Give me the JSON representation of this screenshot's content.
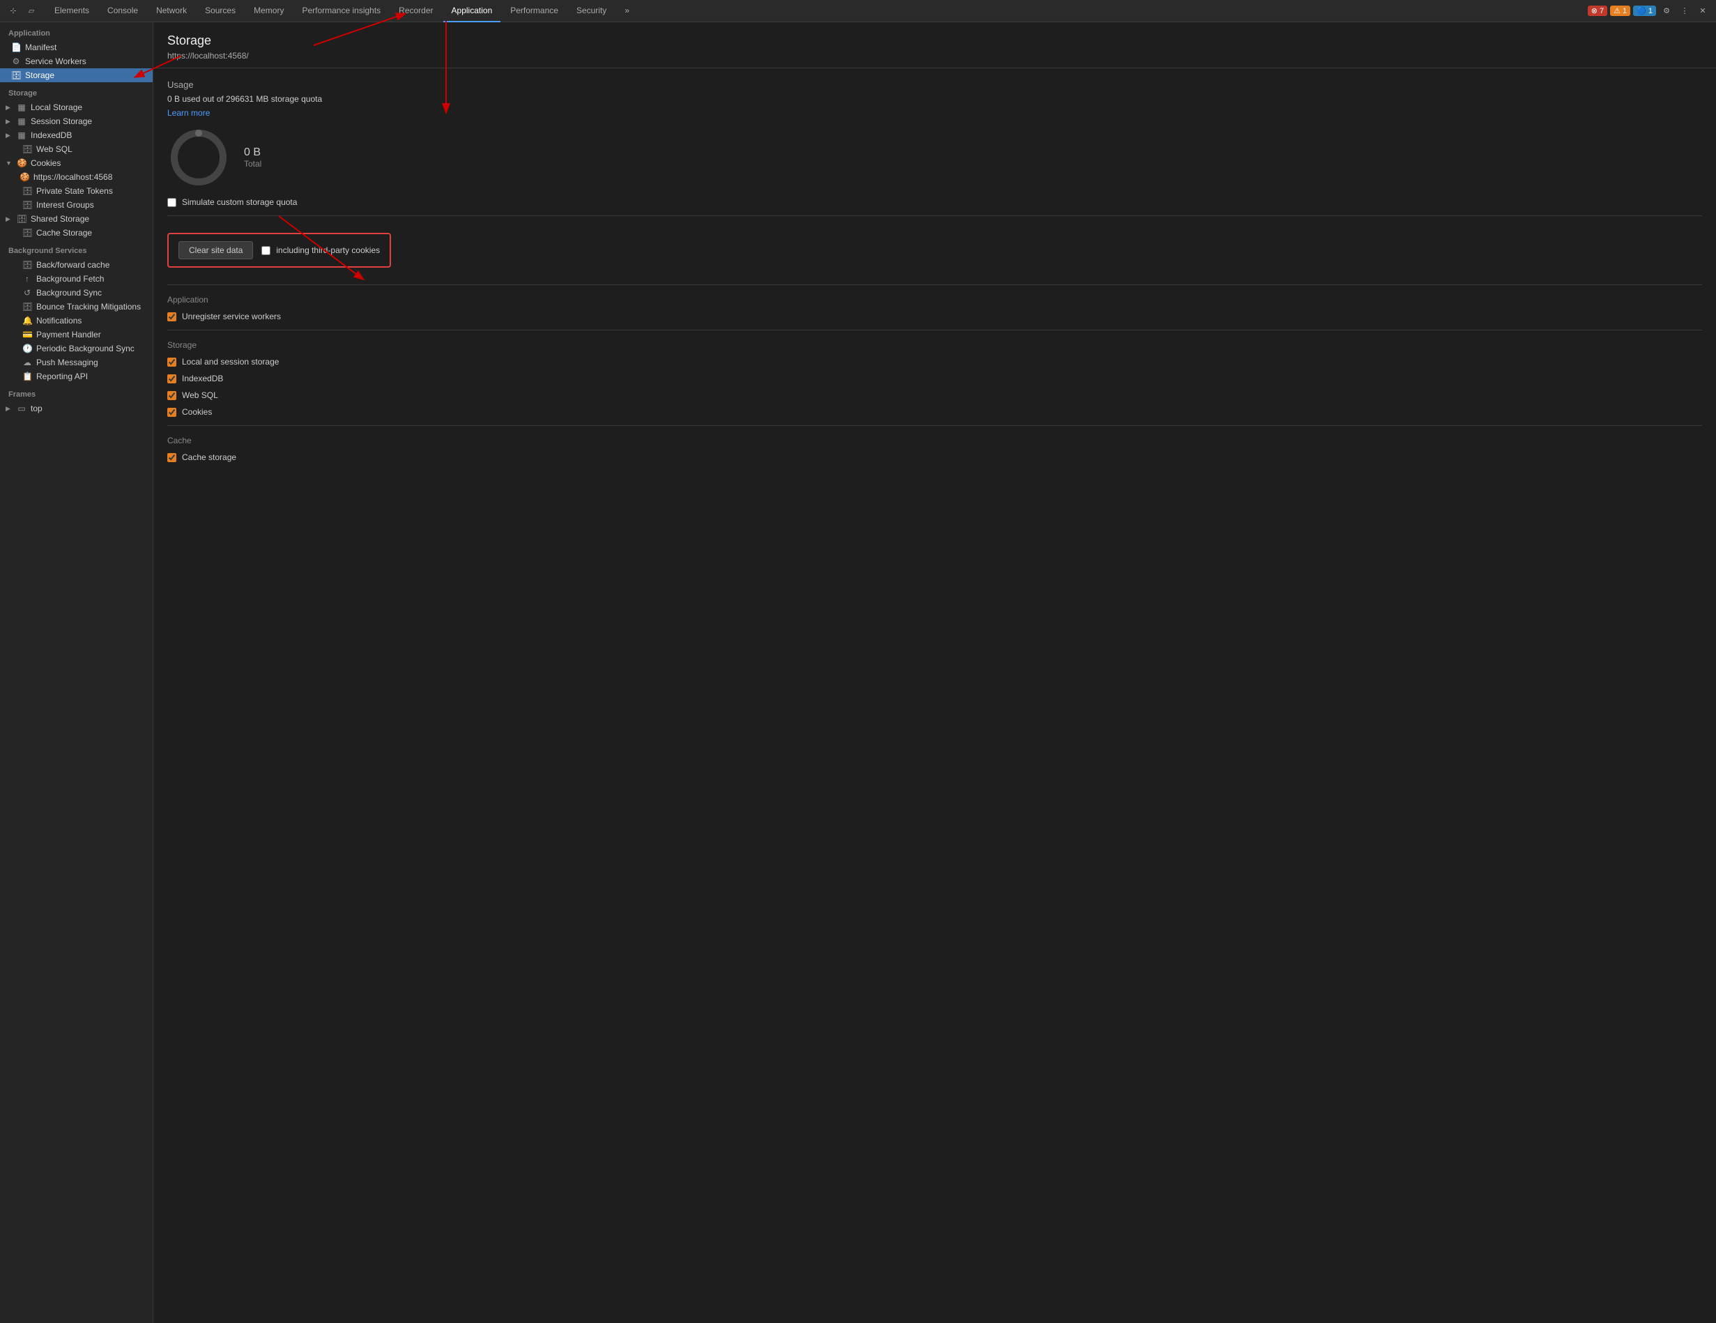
{
  "toolbar": {
    "tabs": [
      {
        "label": "Elements",
        "active": false
      },
      {
        "label": "Console",
        "active": false
      },
      {
        "label": "Network",
        "active": false
      },
      {
        "label": "Sources",
        "active": false
      },
      {
        "label": "Memory",
        "active": false
      },
      {
        "label": "Performance insights",
        "active": false
      },
      {
        "label": "Recorder",
        "active": false
      },
      {
        "label": "Application",
        "active": true
      },
      {
        "label": "Performance",
        "active": false
      },
      {
        "label": "Security",
        "active": false
      }
    ],
    "badges": {
      "error": "⊗ 7",
      "warn": "⚠ 1",
      "info": "🔵 1"
    }
  },
  "sidebar": {
    "application_label": "Application",
    "manifest_label": "Manifest",
    "service_workers_label": "Service Workers",
    "storage_label": "Storage",
    "storage_section_label": "Storage",
    "local_storage_label": "Local Storage",
    "session_storage_label": "Session Storage",
    "indexeddb_label": "IndexedDB",
    "web_sql_label": "Web SQL",
    "cookies_label": "Cookies",
    "cookies_url_label": "https://localhost:4568",
    "private_state_tokens_label": "Private State Tokens",
    "interest_groups_label": "Interest Groups",
    "shared_storage_label": "Shared Storage",
    "cache_storage_label": "Cache Storage",
    "background_services_label": "Background Services",
    "back_forward_cache_label": "Back/forward cache",
    "background_fetch_label": "Background Fetch",
    "background_sync_label": "Background Sync",
    "bounce_tracking_label": "Bounce Tracking Mitigations",
    "notifications_label": "Notifications",
    "payment_handler_label": "Payment Handler",
    "periodic_bg_sync_label": "Periodic Background Sync",
    "push_messaging_label": "Push Messaging",
    "reporting_api_label": "Reporting API",
    "frames_label": "Frames",
    "top_label": "top"
  },
  "content": {
    "title": "Storage",
    "url": "https://localhost:4568/",
    "usage_label": "Usage",
    "usage_text": "0 B used out of 296631 MB storage quota",
    "learn_more": "Learn more",
    "donut_size": "0 B",
    "donut_label": "Total",
    "simulate_label": "Simulate custom storage quota",
    "clear_btn_label": "Clear site data",
    "third_party_label": "including third-party cookies",
    "application_section": "Application",
    "unregister_sw_label": "Unregister service workers",
    "storage_section": "Storage",
    "local_session_label": "Local and session storage",
    "indexeddb_check_label": "IndexedDB",
    "web_sql_check_label": "Web SQL",
    "cookies_check_label": "Cookies",
    "cache_section": "Cache",
    "cache_storage_check_label": "Cache storage"
  }
}
